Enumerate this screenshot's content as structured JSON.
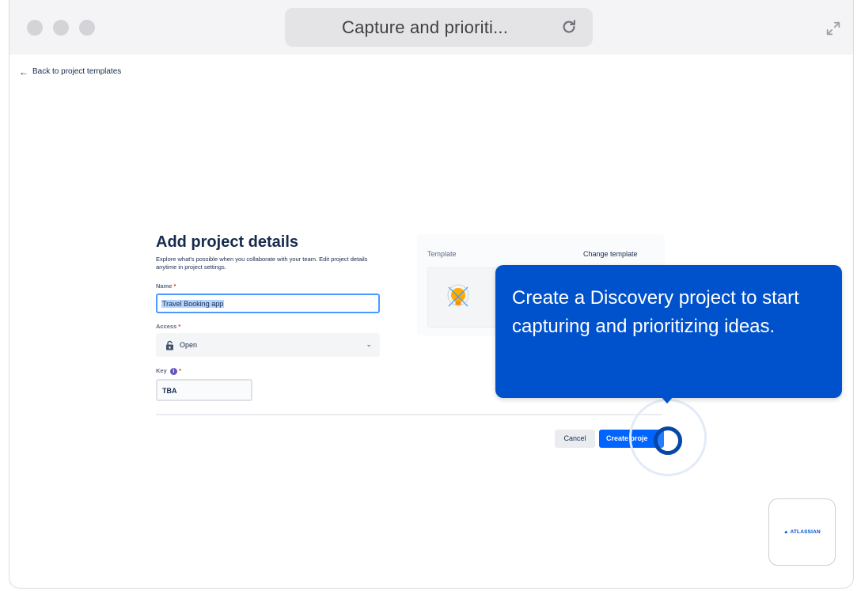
{
  "window": {
    "tab_title": "Capture and prioriti...",
    "icons": {
      "reload": "reload-icon",
      "expand": "expand-icon"
    }
  },
  "nav": {
    "back_link": "Back to project templates"
  },
  "form": {
    "title": "Add project details",
    "description": "Explore what's possible when you collaborate with your team. Edit project details anytime in project settings.",
    "name": {
      "label": "Name",
      "value": "Travel Booking app"
    },
    "access": {
      "label": "Access",
      "value": "Open"
    },
    "key": {
      "label": "Key",
      "value": "TBA"
    },
    "required_marker": "*"
  },
  "template": {
    "label": "Template",
    "change_label": "Change template"
  },
  "actions": {
    "cancel": "Cancel",
    "create": "Create proje"
  },
  "tooltip": {
    "text": "Create a Discovery project to start capturing and prioritizing ideas."
  },
  "badge": {
    "logo_text": "ATLASSIAN"
  },
  "colors": {
    "primary": "#0052cc",
    "button_blue": "#0065ff",
    "focus_ring": "#0747a6",
    "required": "#de350b"
  }
}
